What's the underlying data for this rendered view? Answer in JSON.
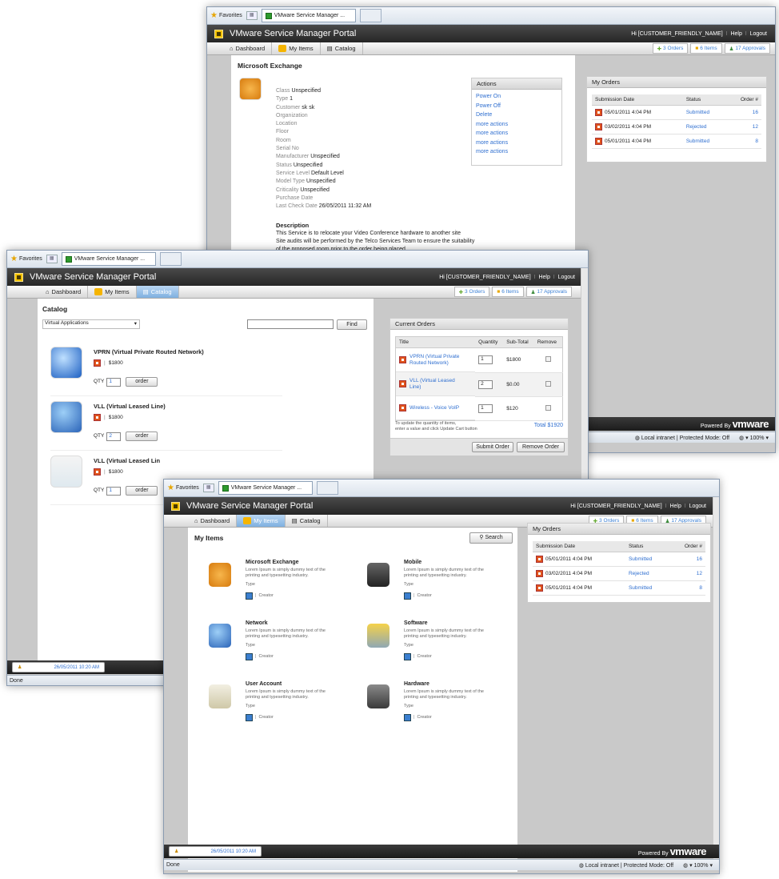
{
  "ie": {
    "favorites": "Favorites",
    "tab": "VMware Service Manager ...",
    "status_done": "Done",
    "zone": "Local intranet | Protected Mode: Off",
    "zoom": "100%"
  },
  "app": {
    "title": "VMware Service Manager Portal",
    "greeting": "Hi [CUSTOMER_FRIENDLY_NAME]",
    "help": "Help",
    "logout": "Logout",
    "sep": "I",
    "powered": "Powered By",
    "vm": "vmware",
    "last_login_label": "Last Login",
    "last_login": "26/05/2011 10:20 AM",
    "tabs": {
      "dashboard": "Dashboard",
      "items": "My Items",
      "catalog": "Catalog"
    },
    "badges": {
      "orders": "3 Orders",
      "items": "6 Items",
      "approvals": "17 Approvals"
    }
  },
  "detail": {
    "title": "Microsoft Exchange",
    "props": [
      [
        "Class",
        "Unspecified"
      ],
      [
        "Type",
        "1"
      ],
      [
        "Customer",
        "sk sk"
      ],
      [
        "Organization",
        ""
      ],
      [
        "Location",
        ""
      ],
      [
        "Floor",
        ""
      ],
      [
        "Room",
        ""
      ],
      [
        "Serial No",
        ""
      ],
      [
        "Manufacturer",
        "Unspecified"
      ],
      [
        "Status",
        "Unspecified"
      ],
      [
        "Service Level",
        "Default Level"
      ],
      [
        "Model Type",
        "Unspecified"
      ],
      [
        "Criticality",
        "Unspecified"
      ],
      [
        "Purchase Date",
        ""
      ],
      [
        "Last Check Date",
        "26/05/2011 11:32 AM"
      ]
    ],
    "actions_title": "Actions",
    "actions": [
      "Power On",
      "Power Off",
      "Delete",
      "more actions",
      "more actions",
      "more actions",
      "more actions"
    ],
    "desc_title": "Description",
    "desc": [
      "This Service is to relocate your Video Conference hardware to another site",
      "Site audits will be performed by the Telco Services Team to ensure the suitability",
      "of the proposed room prior to the order being placed."
    ]
  },
  "orders": {
    "title": "My Orders",
    "cols": [
      "Submission Date",
      "Status",
      "Order #"
    ],
    "rows": [
      [
        "05/01/2011 4:04 PM",
        "Submitted",
        "16"
      ],
      [
        "03/02/2011 4:04 PM",
        "Rejected",
        "12"
      ],
      [
        "05/01/2011 4:04 PM",
        "Submitted",
        "8"
      ]
    ]
  },
  "catalog": {
    "title": "Catalog",
    "dropdown": "Virtual Applications",
    "find": "Find",
    "qty": "QTY",
    "order": "order",
    "items": [
      {
        "name": "VPRN (Virtual Private Routed Network)",
        "price": "$1800",
        "qty": "1"
      },
      {
        "name": "VLL (Virtual Leased Line)",
        "price": "$1800",
        "qty": "2"
      },
      {
        "name": "VLL (Virtual Leased Lin",
        "price": "$1800",
        "qty": "1"
      }
    ],
    "cart_title": "Current Orders",
    "cart_cols": [
      "Title",
      "Quantity",
      "Sub-Total",
      "Remove"
    ],
    "cart": [
      {
        "title": "VPRN (Virtual Private Routed Network)",
        "qty": "1",
        "sub": "$1800"
      },
      {
        "title": "VLL (Virtual Leased Line)",
        "qty": "2",
        "sub": "$0.00"
      },
      {
        "title": "Wireless - Voice VoIP",
        "qty": "1",
        "sub": "$120"
      }
    ],
    "note1": "To update the quantity of items,",
    "note2": "enter a value and click Update Cart button",
    "total": "Total $1920",
    "submit": "Submit Order",
    "remove": "Remove Order"
  },
  "myitems": {
    "title": "My Items",
    "search": "Search",
    "lorem": "Lorem Ipsum is simply dummy text of the",
    "lorem2": "printing and typesetting industry.",
    "type": "Type",
    "creator": "Creator",
    "items": [
      "Microsoft Exchange",
      "Mobile",
      "Network",
      "Software",
      "User Account",
      "Hardware"
    ]
  }
}
